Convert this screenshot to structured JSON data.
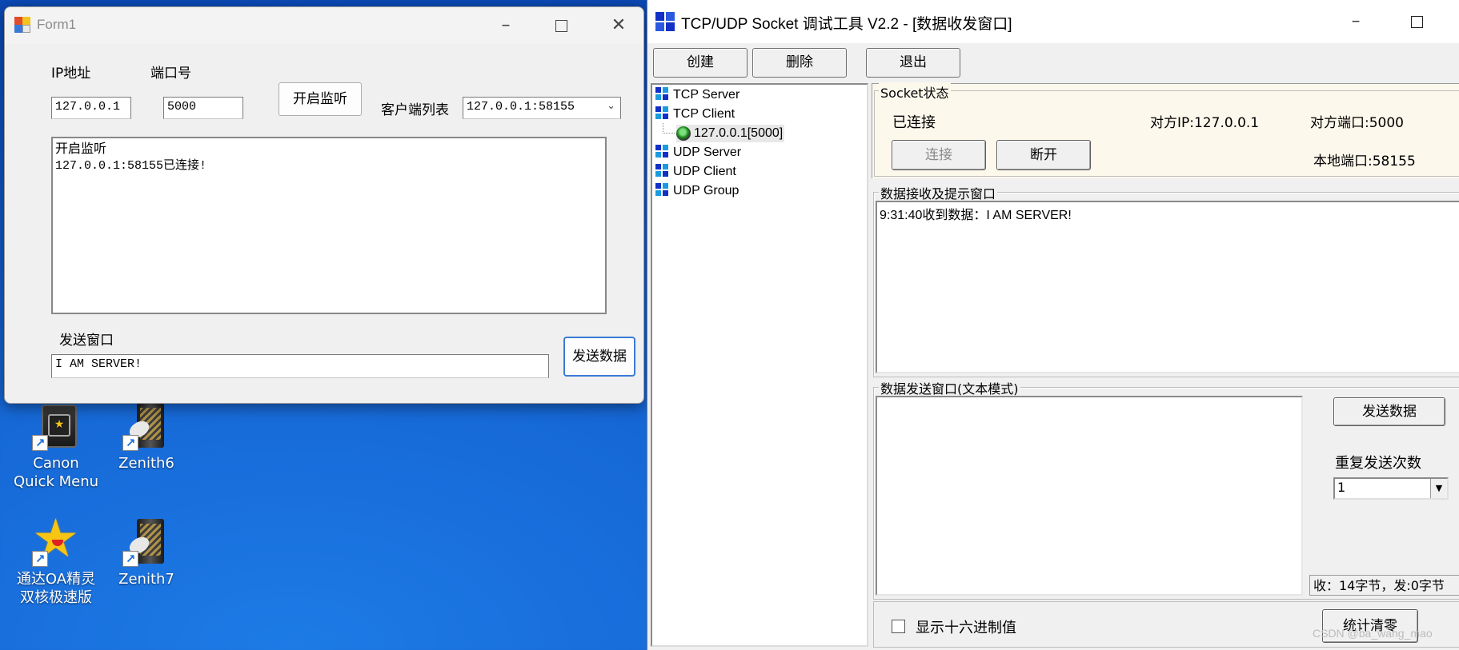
{
  "desktop": {
    "icons": [
      {
        "label_line1": "Canon",
        "label_line2": "Quick Menu",
        "icon": "canon-quick-menu-icon"
      },
      {
        "label_line1": "Zenith6",
        "label_line2": "",
        "icon": "zenith-icon"
      },
      {
        "label_line1": "通达OA精灵",
        "label_line2": "双核极速版",
        "icon": "star-icon"
      },
      {
        "label_line1": "Zenith7",
        "label_line2": "",
        "icon": "zenith-icon"
      }
    ]
  },
  "form1": {
    "title": "Form1",
    "ip_label": "IP地址",
    "port_label": "端口号",
    "ip_value": "127.0.0.1",
    "port_value": "5000",
    "listen_button": "开启监听",
    "client_list_label": "客户端列表",
    "client_list_selected": "127.0.0.1:58155",
    "log_lines": [
      "开启监听",
      "127.0.0.1:58155已连接!"
    ],
    "send_label": "发送窗口",
    "send_value": "I AM SERVER!",
    "send_button": "发送数据"
  },
  "socket_tool": {
    "title": "TCP/UDP Socket 调试工具 V2.2 - [数据收发窗口]",
    "toolbar": {
      "create": "创建",
      "delete": "删除",
      "exit": "退出"
    },
    "tree": {
      "tcp_server": "TCP Server",
      "tcp_client": "TCP Client",
      "tcp_client_child": "127.0.0.1[5000]",
      "udp_server": "UDP Server",
      "udp_client": "UDP Client",
      "udp_group": "UDP Group"
    },
    "status": {
      "group_title": "Socket状态",
      "state": "已连接",
      "remote_ip": "对方IP:127.0.0.1",
      "remote_port": "对方端口:5000",
      "local_port": "本地端口:58155",
      "connect_button": "连接",
      "disconnect_button": "断开"
    },
    "receive": {
      "group_title": "数据接收及提示窗口",
      "content": "9:31:40收到数据：I AM SERVER!"
    },
    "send": {
      "group_title": "数据发送窗口(文本模式)",
      "send_button": "发送数据",
      "repeat_label": "重复发送次数",
      "repeat_value": "1",
      "counter": "收：14字节，发:0字节"
    },
    "hex_checkbox_label": "显示十六进制值",
    "stats_clear_button": "统计清零"
  },
  "watermark": "CSDN @ba_wang_mao"
}
